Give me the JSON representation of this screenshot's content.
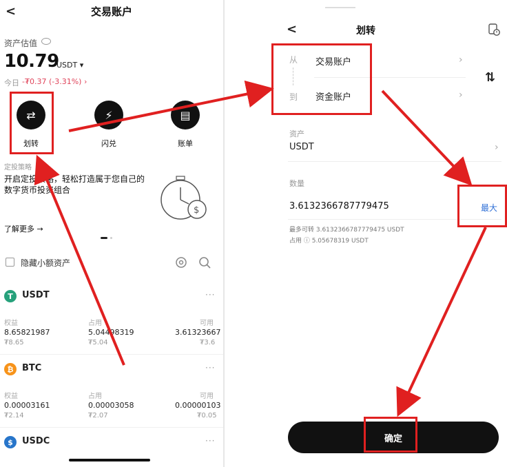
{
  "left": {
    "title": "交易账户",
    "back": "<",
    "asset_label": "资产估值",
    "balance": "10.79",
    "balance_unit": "USDT ▾",
    "today_label": "今日",
    "today_change": "-₮0.37 (-3.31%) ›",
    "actions": [
      {
        "label": "划转",
        "icon": "transfer-icon",
        "glyph": "⇄"
      },
      {
        "label": "闪兑",
        "icon": "flash-icon",
        "glyph": "⚡"
      },
      {
        "label": "账单",
        "icon": "bill-icon",
        "glyph": "▤"
      }
    ],
    "promo_small": "定投策略",
    "promo_text": "开启定投策略，轻松打造属于您自己的数字货币投资组合",
    "learn_more": "了解更多 →",
    "hide_small": "隐藏小额资产",
    "columns": [
      "权益",
      "占用",
      "可用"
    ],
    "coins": [
      {
        "name": "USDT",
        "color": "#26a17b",
        "glyph": "T",
        "equity": "8.65821987",
        "equity_fiat": "₮8.65",
        "used": "5.04498319",
        "used_fiat": "₮5.04",
        "avail": "3.61323667",
        "avail_fiat": "₮3.6"
      },
      {
        "name": "BTC",
        "color": "#f7931a",
        "glyph": "₿",
        "equity": "0.00003161",
        "equity_fiat": "₮2.14",
        "used": "0.00003058",
        "used_fiat": "₮2.07",
        "avail": "0.00000103",
        "avail_fiat": "₮0.05"
      },
      {
        "name": "USDC",
        "color": "#2775ca",
        "glyph": "$"
      }
    ],
    "more": "···"
  },
  "right": {
    "title": "划转",
    "back": "<",
    "from_label": "从",
    "from_account": "交易账户",
    "to_label": "到",
    "to_account": "资金账户",
    "asset_label": "资产",
    "asset_value": "USDT",
    "amount_label": "数量",
    "amount_value": "3.6132366787779475",
    "max_label": "最大",
    "max_transferable": "最多可转 3.6132366787779475 USDT",
    "occupied": "占用 ⓘ   5.05678319 USDT",
    "confirm": "确定"
  },
  "colors": {
    "highlight": "#e02020",
    "accent_blue": "#2f6fd6",
    "loss_red": "#e0455b"
  }
}
